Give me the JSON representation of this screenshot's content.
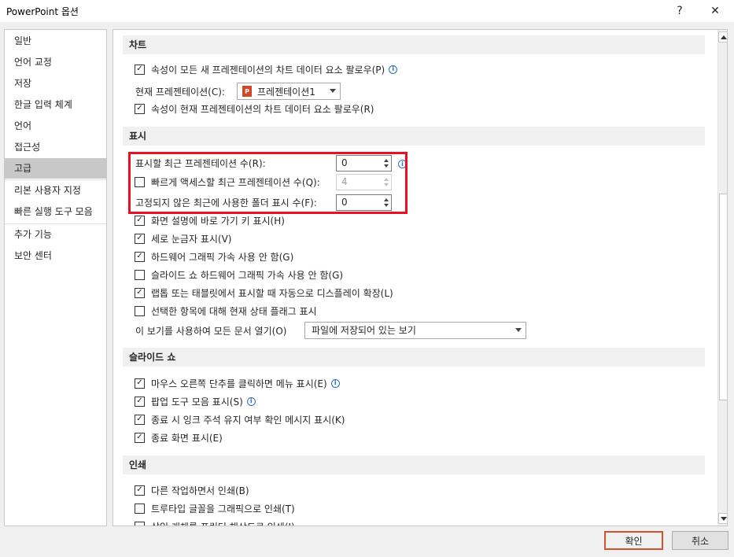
{
  "window": {
    "title": "PowerPoint 옵션",
    "help_label": "?",
    "close_label": "✕"
  },
  "sidebar": {
    "items": [
      {
        "label": "일반"
      },
      {
        "label": "언어 교정"
      },
      {
        "label": "저장"
      },
      {
        "label": "한글 입력 체계"
      },
      {
        "label": "언어"
      },
      {
        "label": "접근성"
      },
      {
        "label": "고급",
        "active": true
      },
      {
        "label": "리본 사용자 지정"
      },
      {
        "label": "빠른 실행 도구 모음"
      },
      {
        "label": "추가 기능"
      },
      {
        "label": "보안 센터"
      }
    ]
  },
  "sections": {
    "chart": {
      "title": "차트",
      "opt1": {
        "label": "속성이 모든 새 프레젠테이션의 차트 데이터 요소 팔로우(P)",
        "checked": true
      },
      "current_label": "현재 프레젠테이션(C):",
      "current_value": "프레젠테이션1",
      "opt2": {
        "label": "속성이 현재 프레젠테이션의 차트 데이터 요소 팔로우(R)",
        "checked": true
      }
    },
    "display": {
      "title": "표시",
      "recent_label": "표시할 최근 프레젠테이션 수(R):",
      "recent_value": "0",
      "quick_label": "빠르게 액세스할 최근 프레젠테이션 수(Q):",
      "quick_checked": false,
      "quick_value": "4",
      "folders_label": "고정되지 않은 최근에 사용한 폴더 표시 수(F):",
      "folders_value": "0",
      "opt_shortcut": {
        "label": "화면 설명에 바로 가기 키 표시(H)",
        "checked": true
      },
      "opt_ruler": {
        "label": "세로 눈금자 표시(V)",
        "checked": true
      },
      "opt_hw": {
        "label": "하드웨어 그래픽 가속 사용 안 함(G)",
        "checked": true
      },
      "opt_slideshow_hw": {
        "label": "슬라이드 쇼 하드웨어 그래픽 가속 사용 안 함(G)",
        "checked": false
      },
      "opt_tablet": {
        "label": "랩톱 또는 태블릿에서 표시할 때 자동으로 디스플레이 확장(L)",
        "checked": true
      },
      "opt_status": {
        "label": "선택한 항목에 대해 현재 상태 플래그 표시",
        "checked": false
      },
      "view_label": "이 보기를 사용하여 모든 문서 열기(O)",
      "view_value": "파일에 저장되어 있는 보기"
    },
    "slideshow": {
      "title": "슬라이드 쇼",
      "opt_menu": {
        "label": "마우스 오른쪽 단추를 클릭하면 메뉴 표시(E)",
        "checked": true
      },
      "opt_popup": {
        "label": "팝업 도구 모음 표시(S)",
        "checked": true
      },
      "opt_ink": {
        "label": "종료 시 잉크 주석 유지 여부 확인 메시지 표시(K)",
        "checked": true
      },
      "opt_end": {
        "label": "종료 화면 표시(E)",
        "checked": true
      }
    },
    "print": {
      "title": "인쇄",
      "opt_bg": {
        "label": "다른 작업하면서 인쇄(B)",
        "checked": true
      },
      "opt_tt": {
        "label": "트루타입 글꼴을 그래픽으로 인쇄(T)",
        "checked": false
      },
      "opt_ins": {
        "label": "삽입 개체를 프린터 해상도로 인쇄(I)",
        "checked": false
      }
    }
  },
  "buttons": {
    "ok": "확인",
    "cancel": "취소"
  },
  "icons": {
    "check": "✓",
    "info": "i",
    "ppt": "P"
  },
  "colors": {
    "highlight": "#e81123",
    "accent": "#d35230"
  }
}
